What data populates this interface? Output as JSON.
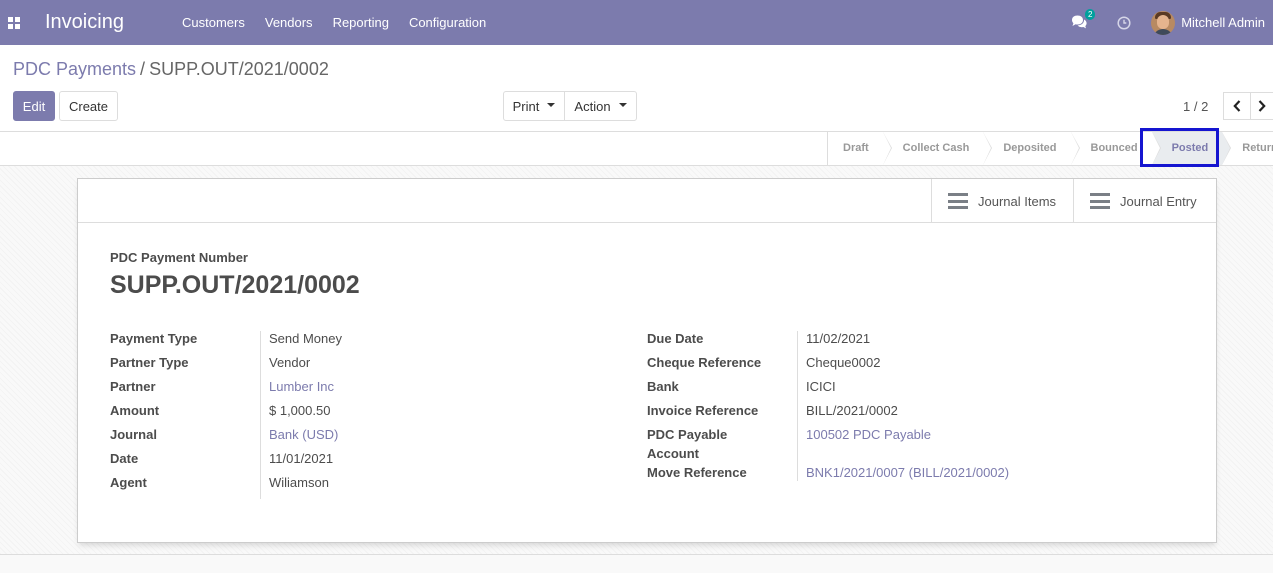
{
  "navbar": {
    "app_title": "Invoicing",
    "menu": [
      "Customers",
      "Vendors",
      "Reporting",
      "Configuration"
    ],
    "chat_badge": "2",
    "user_name": "Mitchell Admin",
    "color": "#7c7bad"
  },
  "breadcrumb": {
    "parent": "PDC Payments",
    "separator": "/",
    "current": "SUPP.OUT/2021/0002"
  },
  "toolbar": {
    "edit_label": "Edit",
    "create_label": "Create",
    "print_label": "Print",
    "action_label": "Action"
  },
  "pager": {
    "value": "1 / 2"
  },
  "statusbar": {
    "stages": [
      "Draft",
      "Collect Cash",
      "Deposited",
      "Bounced",
      "Posted",
      "Returned"
    ],
    "active_stage": "Posted"
  },
  "smart_buttons": {
    "journal_items": "Journal Items",
    "journal_entry": "Journal Entry"
  },
  "form": {
    "number_label": "PDC Payment Number",
    "name": "SUPP.OUT/2021/0002",
    "left_fields": [
      {
        "label": "Payment Type",
        "value": "Send Money"
      },
      {
        "label": "Partner Type",
        "value": "Vendor"
      },
      {
        "label": "Partner",
        "value": "Lumber Inc"
      },
      {
        "label": "Amount",
        "value": "$ 1,000.50"
      },
      {
        "label": "Journal",
        "value": "Bank (USD)"
      },
      {
        "label": "Date",
        "value": "11/01/2021"
      },
      {
        "label": "Agent",
        "value": "Wiliamson"
      }
    ],
    "right_fields": [
      {
        "label": "Due Date",
        "value": "11/02/2021"
      },
      {
        "label": "Cheque Reference",
        "value": "Cheque0002"
      },
      {
        "label": "Bank",
        "value": "ICICI"
      },
      {
        "label": "Invoice Reference",
        "value": "BILL/2021/0002"
      },
      {
        "label": "PDC Payable",
        "label_line2": "Account",
        "value": "100502 PDC Payable"
      },
      {
        "label": "Move Reference",
        "value": "BNK1/2021/0007 (BILL/2021/0002)"
      }
    ]
  }
}
